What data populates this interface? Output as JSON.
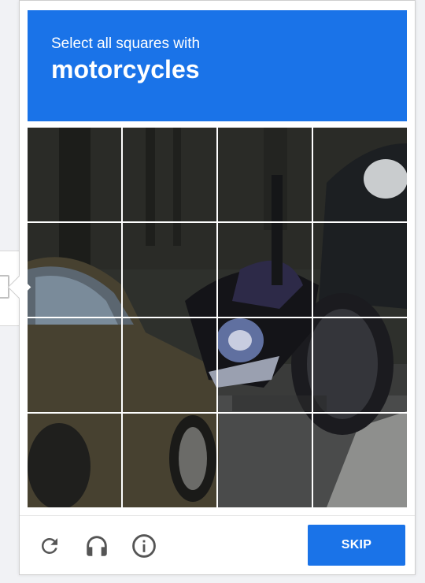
{
  "challenge": {
    "prompt": "Select all squares with",
    "keyword": "motorcycles",
    "grid_rows": 4,
    "grid_cols": 4
  },
  "footer": {
    "reload_icon": "reload-icon",
    "audio_icon": "headphones-icon",
    "info_icon": "info-icon",
    "skip_label": "SKIP"
  },
  "colors": {
    "accent": "#1a73e8",
    "icon_gray": "#555555"
  }
}
